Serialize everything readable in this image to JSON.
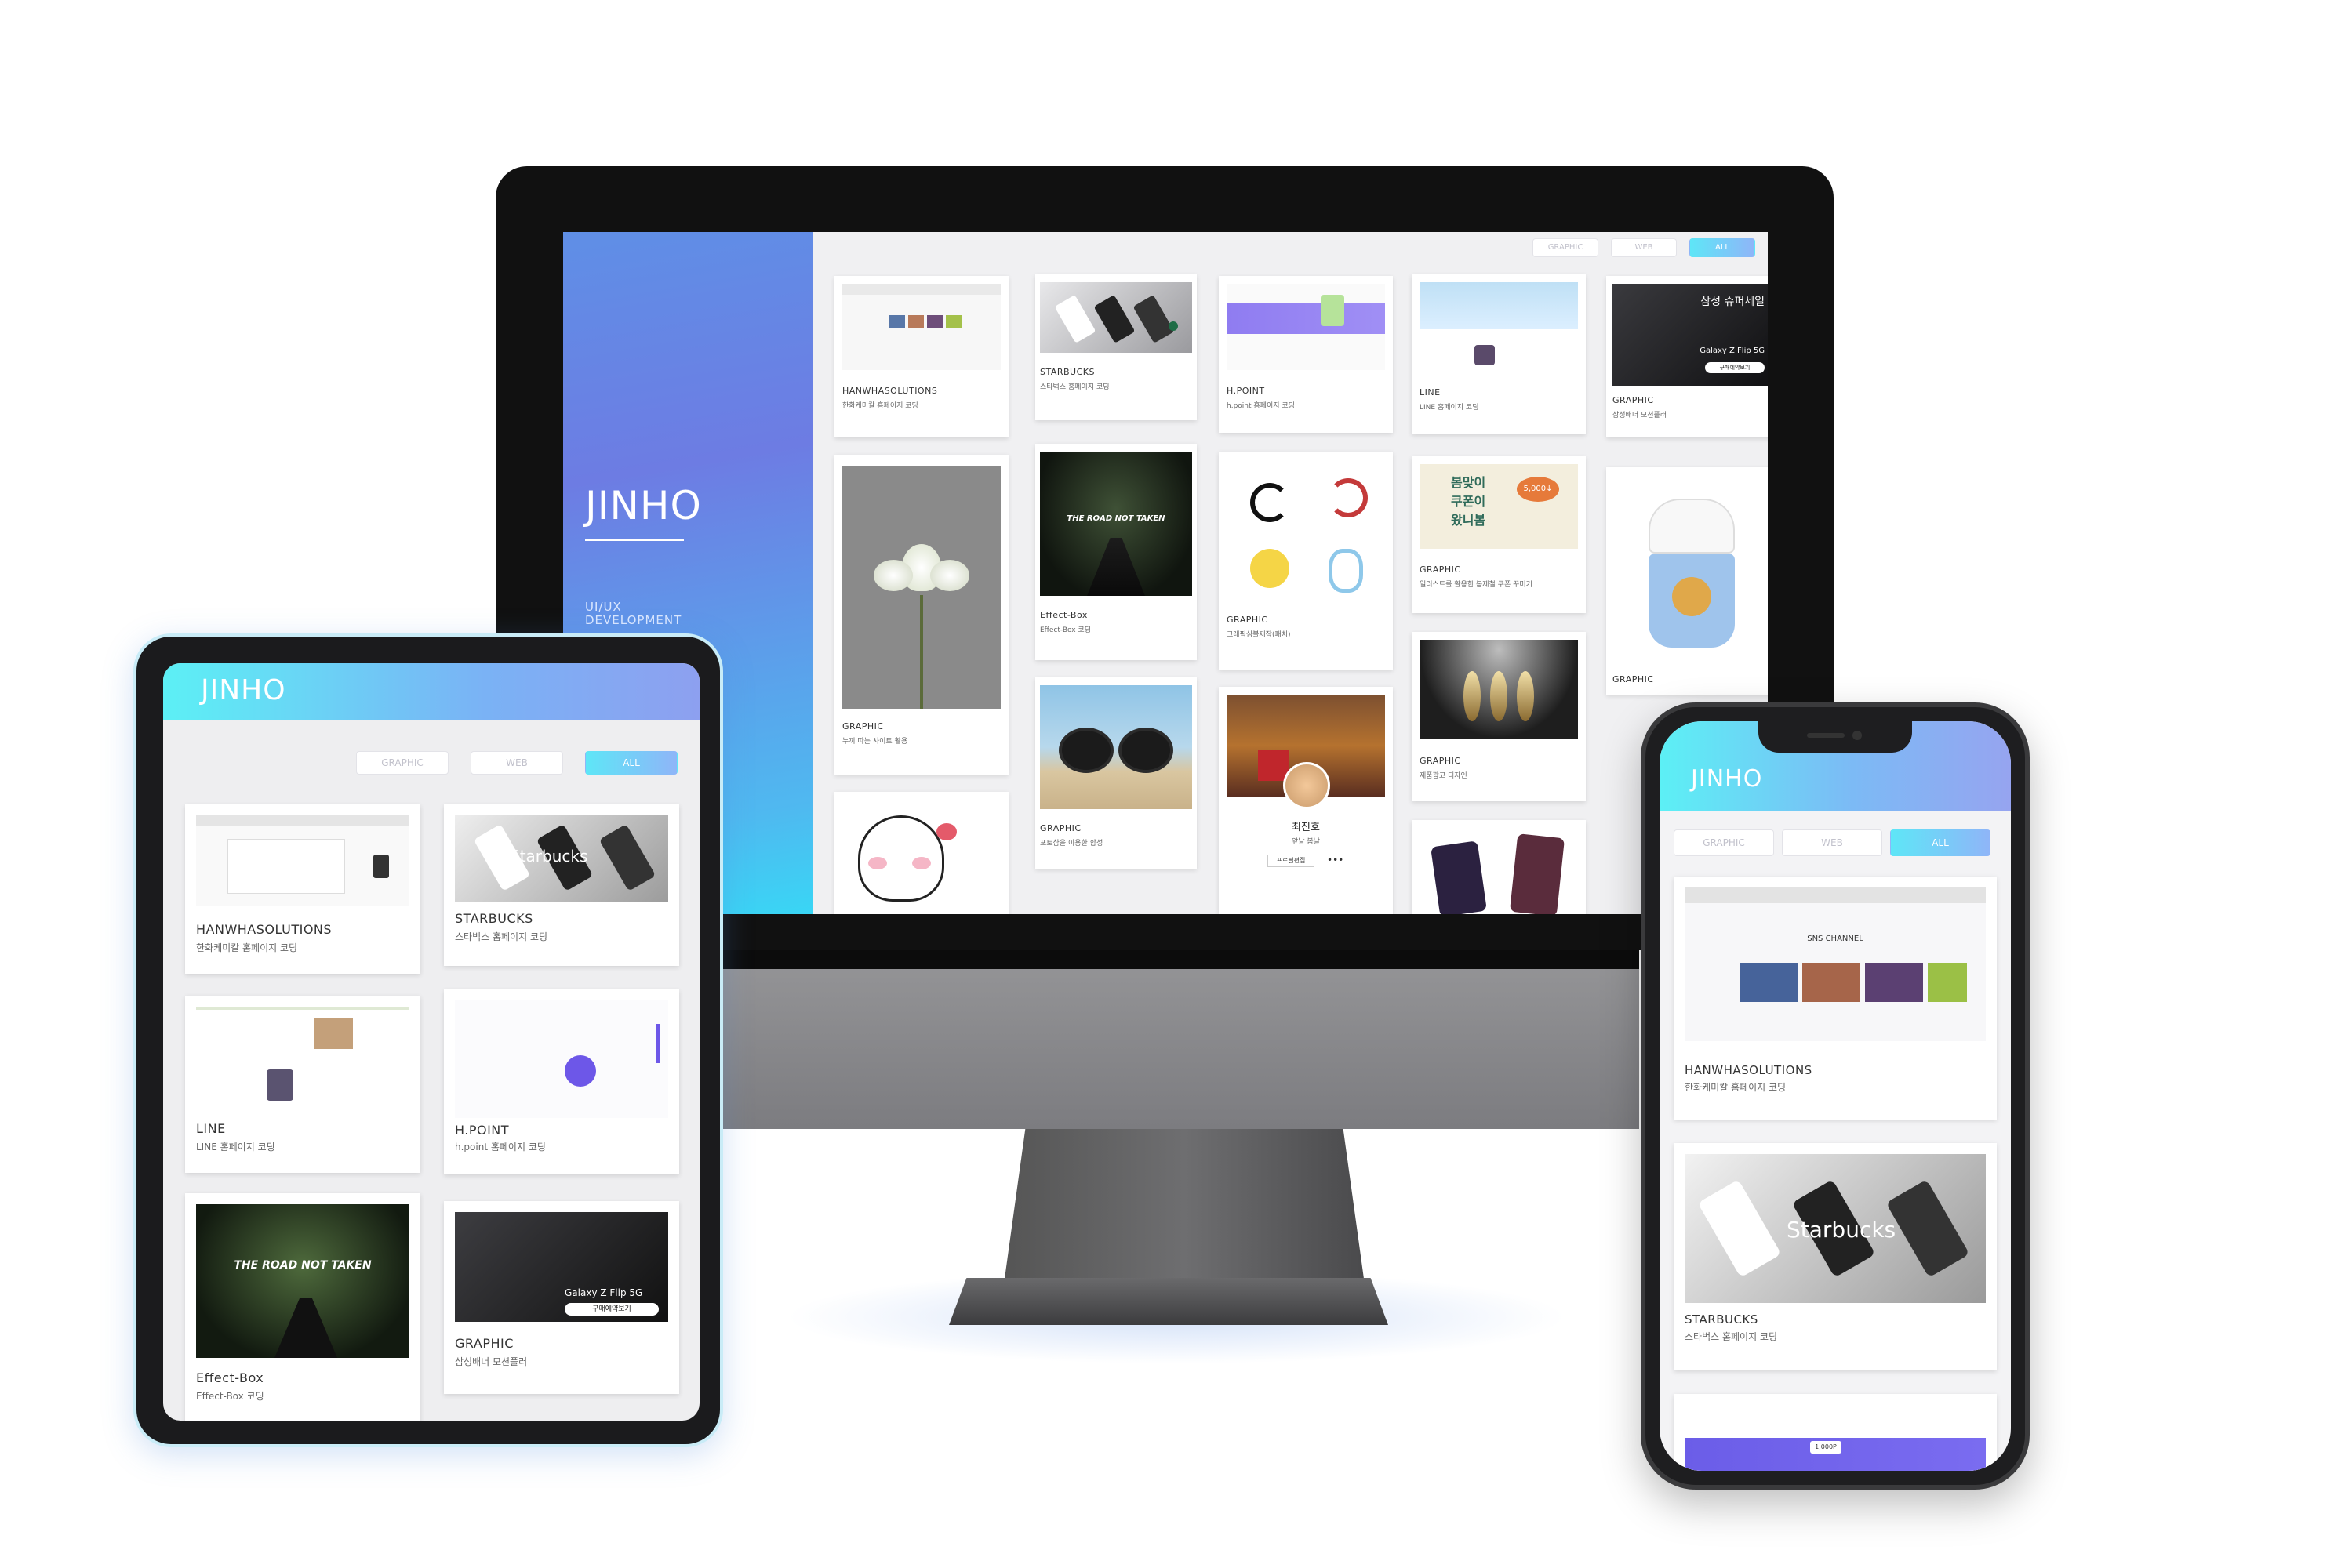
{
  "brand": "JINHO",
  "monitor": {
    "sidebar_sub_1": "UI/UX",
    "sidebar_sub_2": "DEVELOPMENT",
    "filters": [
      "GRAPHIC",
      "WEB",
      "ALL"
    ],
    "cards": [
      {
        "title": "HANWHASOLUTIONS",
        "desc": "한화케미칼 홈페이지 코딩"
      },
      {
        "title": "STARBUCKS",
        "desc": "스타벅스 홈페이지 코딩"
      },
      {
        "title": "H.POINT",
        "desc": "h.point 홈페이지 코딩"
      },
      {
        "title": "LINE",
        "desc": "LINE 홈페이지 코딩"
      },
      {
        "title": "GRAPHIC",
        "desc": "삼성배너 모션플러"
      },
      {
        "title": "GRAPHIC",
        "desc": "누끼 따는 사이트 활용"
      },
      {
        "title": "Effect-Box",
        "desc": "Effect-Box 코딩"
      },
      {
        "title": "GRAPHIC",
        "desc": "그래픽심볼제작(패치)"
      },
      {
        "title": "GRAPHIC",
        "desc": "일러스트를 활용한 봄제철 쿠폰 꾸미기"
      },
      {
        "title": "GRAPHIC",
        "desc": ""
      },
      {
        "title": "GRAPHIC",
        "desc": "포토샵을 이용한 합성"
      },
      {
        "title": "GRAPHIC",
        "desc": "제품광고 디자인"
      }
    ],
    "banner_text_1": "삼성 슈퍼세일",
    "banner_text_2": "Galaxy Z Flip 5G",
    "banner_btn": "구매예약보기",
    "road_text": "THE ROAD NOT TAKEN",
    "coupon_text_1": "봄맞이",
    "coupon_text_2": "쿠폰이",
    "coupon_text_3": "왔니봄",
    "coupon_price": "5,000↓",
    "profile_name": "최진호",
    "profile_sub": "앞날 봄날",
    "profile_btn": "프로필편집"
  },
  "tablet": {
    "filters": [
      "GRAPHIC",
      "WEB",
      "ALL"
    ],
    "cards": [
      {
        "title": "HANWHASOLUTIONS",
        "desc": "한화케미칼 홈페이지 코딩"
      },
      {
        "title": "STARBUCKS",
        "desc": "스타벅스 홈페이지 코딩"
      },
      {
        "title": "LINE",
        "desc": "LINE 홈페이지 코딩"
      },
      {
        "title": "H.POINT",
        "desc": "h.point 홈페이지 코딩"
      },
      {
        "title": "Effect-Box",
        "desc": "Effect-Box 코딩"
      },
      {
        "title": "GRAPHIC",
        "desc": "삼성배너 모션플러"
      }
    ],
    "starbucks_word": "Starbucks",
    "road_text": "THE ROAD NOT TAKEN",
    "banner_text": "Galaxy Z Flip 5G",
    "banner_btn": "구매예약보기"
  },
  "phone": {
    "filters": [
      "GRAPHIC",
      "WEB",
      "ALL"
    ],
    "cards": [
      {
        "title": "HANWHASOLUTIONS",
        "desc": "한화케미칼 홈페이지 코딩"
      },
      {
        "title": "STARBUCKS",
        "desc": "스타벅스 홈페이지 코딩"
      }
    ],
    "starbucks_word": "Starbucks",
    "hanwha_channel": "SNS CHANNEL",
    "hpoint_points": "1,000P"
  },
  "colors": {
    "accent_blue": "#6d7ce3",
    "accent_cyan": "#5cf0f5",
    "bezel": "#111111"
  }
}
